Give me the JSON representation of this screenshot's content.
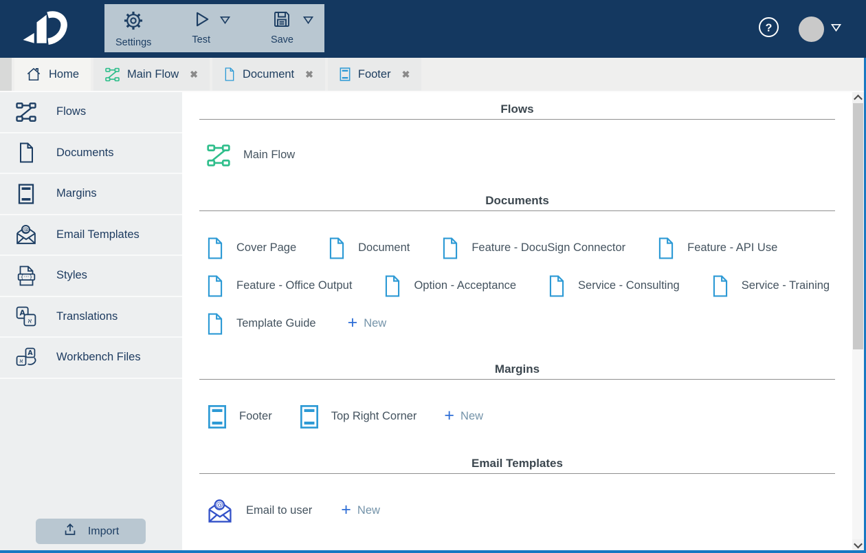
{
  "header": {
    "toolbar": {
      "settings_label": "Settings",
      "test_label": "Test",
      "save_label": "Save"
    },
    "help_glyph": "?"
  },
  "tabs": [
    {
      "label": "Home",
      "icon": "home-icon",
      "icon_color": "#1d3e63",
      "active": true,
      "closable": false
    },
    {
      "label": "Main Flow",
      "icon": "flow-icon",
      "icon_color": "#2ebe8b",
      "active": false,
      "closable": true
    },
    {
      "label": "Document",
      "icon": "document-icon",
      "icon_color": "#2d9ad5",
      "active": false,
      "closable": true
    },
    {
      "label": "Footer",
      "icon": "margin-icon",
      "icon_color": "#2d9ad5",
      "active": false,
      "closable": true
    }
  ],
  "sidebar": {
    "items": [
      {
        "label": "Flows",
        "icon": "flow-icon"
      },
      {
        "label": "Documents",
        "icon": "document-icon"
      },
      {
        "label": "Margins",
        "icon": "margin-icon"
      },
      {
        "label": "Email Templates",
        "icon": "email-icon"
      },
      {
        "label": "Styles",
        "icon": "styles-icon"
      },
      {
        "label": "Translations",
        "icon": "translations-icon"
      },
      {
        "label": "Workbench Files",
        "icon": "workbench-icon"
      }
    ],
    "import_label": "Import"
  },
  "main": {
    "sections": [
      {
        "title": "Flows",
        "icon": "flow-icon",
        "icon_color": "#2ebe8b",
        "items": [
          {
            "label": "Main Flow"
          }
        ],
        "new_label": null
      },
      {
        "title": "Documents",
        "icon": "document-icon",
        "icon_color": "#2d9ad5",
        "items": [
          {
            "label": "Cover Page"
          },
          {
            "label": "Document"
          },
          {
            "label": "Feature - DocuSign Connector"
          },
          {
            "label": "Feature - API Use"
          },
          {
            "label": "Feature - Office Output"
          },
          {
            "label": "Option - Acceptance"
          },
          {
            "label": "Service - Consulting"
          },
          {
            "label": "Service - Training"
          },
          {
            "label": "Template Guide"
          }
        ],
        "new_label": "New"
      },
      {
        "title": "Margins",
        "icon": "margin-icon",
        "icon_color": "#2d9ad5",
        "items": [
          {
            "label": "Footer"
          },
          {
            "label": "Top Right Corner"
          }
        ],
        "new_label": "New"
      },
      {
        "title": "Email Templates",
        "icon": "email-icon",
        "icon_color": "#3351c8",
        "items": [
          {
            "label": "Email to user"
          }
        ],
        "new_label": "New"
      }
    ]
  },
  "icons": {
    "close_glyph": "✖",
    "plus_glyph": "+"
  },
  "colors": {
    "navy": "#143860",
    "navy_text": "#1d3e63",
    "chip_bg": "#b9c7d1",
    "green": "#2ebe8b",
    "doc_blue": "#2d9ad5",
    "email_blue": "#3351c8",
    "plus_blue": "#2e6ed6",
    "new_text": "#7493a9",
    "window_border": "#1878c2"
  }
}
